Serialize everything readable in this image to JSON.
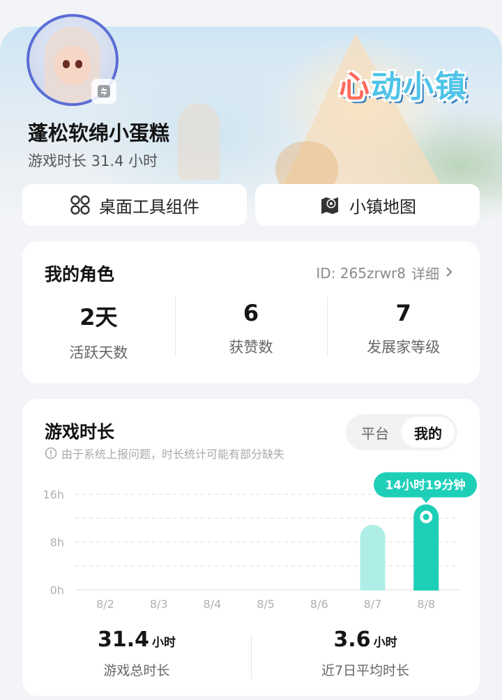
{
  "profile": {
    "username": "蓬松软绵小蛋糕",
    "playtime_label": "游戏时长 31.4 小时",
    "logo_text_a": "心",
    "logo_text_b": "动小镇"
  },
  "quick_actions": [
    {
      "label": "桌面工具组件",
      "icon": "grid-apps-icon"
    },
    {
      "label": "小镇地图",
      "icon": "map-pin-icon"
    }
  ],
  "role_card": {
    "title": "我的角色",
    "id_text": "ID: 265zrwr8",
    "detail_label": "详细",
    "stats": [
      {
        "value": "2天",
        "label": "活跃天数"
      },
      {
        "value": "6",
        "label": "获赞数"
      },
      {
        "value": "7",
        "label": "发展家等级"
      }
    ]
  },
  "time_card": {
    "title": "游戏时长",
    "toggle": {
      "options": [
        "平台",
        "我的"
      ],
      "selected": "我的"
    },
    "notice": "由于系统上报问题，时长统计可能有部分缺失",
    "summary": [
      {
        "value": "31.4",
        "unit": "小时",
        "label": "游戏总时长"
      },
      {
        "value": "3.6",
        "unit": "小时",
        "label": "近7日平均时长"
      }
    ]
  },
  "chart_data": {
    "type": "bar",
    "categories": [
      "8/2",
      "8/3",
      "8/4",
      "8/5",
      "8/6",
      "8/7",
      "8/8"
    ],
    "values": [
      0,
      0,
      0,
      0,
      0,
      10.9,
      14.32
    ],
    "ylim": [
      0,
      16
    ],
    "yticks": [
      "0h",
      "8h",
      "16h"
    ],
    "highlight_index": 6,
    "highlight_label": "14小时19分钟",
    "colors": {
      "normal": "#aeeee6",
      "highlight": "#1ecfb8",
      "grid": "#e2e2e2",
      "label": "#b0b0b0"
    }
  }
}
